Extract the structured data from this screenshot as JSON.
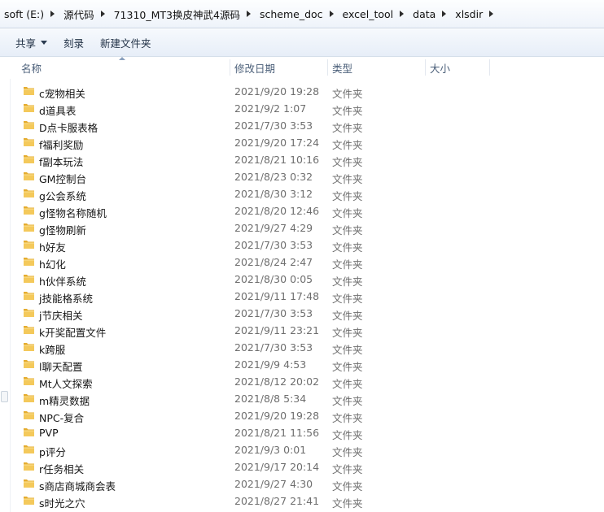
{
  "breadcrumb": [
    "soft (E:)",
    "源代码",
    "71310_MT3换皮神武4源码",
    "scheme_doc",
    "excel_tool",
    "data",
    "xlsdir"
  ],
  "toolbar": {
    "share_label": "共享",
    "burn_label": "刻录",
    "new_folder_label": "新建文件夹"
  },
  "columns": {
    "name": "名称",
    "modified": "修改日期",
    "type": "类型",
    "size": "大小"
  },
  "colors": {
    "folder_body": "#f4c95b",
    "folder_tab": "#e5ac2e",
    "header_text": "#4c607a"
  },
  "files": [
    {
      "name": "c宠物相关",
      "modified": "2021/9/20 19:28",
      "type": "文件夹"
    },
    {
      "name": "d道具表",
      "modified": "2021/9/2 1:07",
      "type": "文件夹"
    },
    {
      "name": "D点卡服表格",
      "modified": "2021/7/30 3:53",
      "type": "文件夹"
    },
    {
      "name": "f福利奖励",
      "modified": "2021/9/20 17:24",
      "type": "文件夹"
    },
    {
      "name": "f副本玩法",
      "modified": "2021/8/21 10:16",
      "type": "文件夹"
    },
    {
      "name": "GM控制台",
      "modified": "2021/8/23 0:32",
      "type": "文件夹"
    },
    {
      "name": "g公会系统",
      "modified": "2021/8/30 3:12",
      "type": "文件夹"
    },
    {
      "name": "g怪物名称随机",
      "modified": "2021/8/20 12:46",
      "type": "文件夹"
    },
    {
      "name": "g怪物刷新",
      "modified": "2021/9/27 4:29",
      "type": "文件夹"
    },
    {
      "name": "h好友",
      "modified": "2021/7/30 3:53",
      "type": "文件夹"
    },
    {
      "name": "h幻化",
      "modified": "2021/8/24 2:47",
      "type": "文件夹"
    },
    {
      "name": "h伙伴系统",
      "modified": "2021/8/30 0:05",
      "type": "文件夹"
    },
    {
      "name": "j技能格系统",
      "modified": "2021/9/11 17:48",
      "type": "文件夹"
    },
    {
      "name": "j节庆相关",
      "modified": "2021/7/30 3:53",
      "type": "文件夹"
    },
    {
      "name": "k开奖配置文件",
      "modified": "2021/9/11 23:21",
      "type": "文件夹"
    },
    {
      "name": "k跨服",
      "modified": "2021/7/30 3:53",
      "type": "文件夹"
    },
    {
      "name": "l聊天配置",
      "modified": "2021/9/9 4:53",
      "type": "文件夹"
    },
    {
      "name": "Mt人文探索",
      "modified": "2021/8/12 20:02",
      "type": "文件夹"
    },
    {
      "name": "m精灵数据",
      "modified": "2021/8/8 5:34",
      "type": "文件夹"
    },
    {
      "name": "NPC-复合",
      "modified": "2021/9/20 19:28",
      "type": "文件夹"
    },
    {
      "name": "PVP",
      "modified": "2021/8/21 11:56",
      "type": "文件夹"
    },
    {
      "name": "p评分",
      "modified": "2021/9/3 0:01",
      "type": "文件夹"
    },
    {
      "name": "r任务相关",
      "modified": "2021/9/17 20:14",
      "type": "文件夹"
    },
    {
      "name": "s商店商城商会表",
      "modified": "2021/9/27 4:30",
      "type": "文件夹"
    },
    {
      "name": "s时光之穴",
      "modified": "2021/8/27 21:41",
      "type": "文件夹"
    }
  ]
}
